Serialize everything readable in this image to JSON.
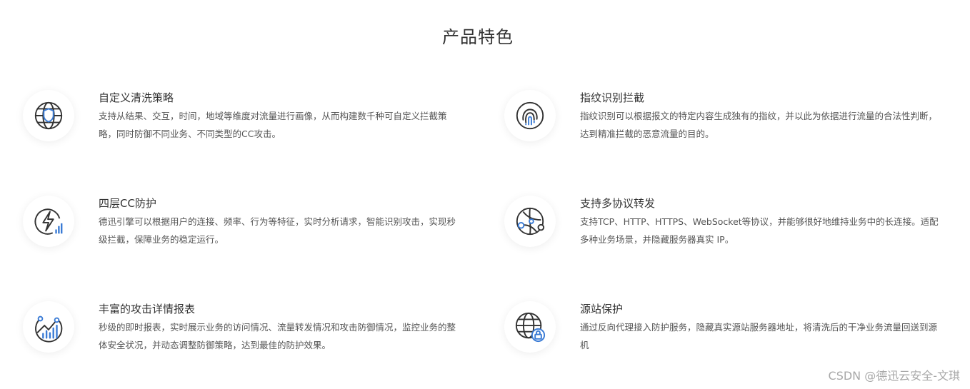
{
  "page": {
    "title": "产品特色"
  },
  "features": [
    {
      "title": "自定义清洗策略",
      "desc": "支持从结果、交互，时间，地域等维度对流量进行画像，从而构建数千种可自定义拦截策略，同时防御不同业务、不同类型的CC攻击。",
      "icon": "globe-shield-icon"
    },
    {
      "title": "指纹识别拦截",
      "desc": "指纹识别可以根据报文的特定内容生成独有的指纹，并以此为依据进行流量的合法性判断，达到精准拦截的恶意流量的目的。",
      "icon": "fingerprint-icon"
    },
    {
      "title": "四层CC防护",
      "desc": "德迅引擎可以根据用户的连接、频率、行为等特征，实时分析请求，智能识别攻击，实现秒级拦截，保障业务的稳定运行。",
      "icon": "lightning-chart-icon"
    },
    {
      "title": "支持多协议转发",
      "desc": "支持TCP、HTTP、HTTPS、WebSocket等协议，并能够很好地维持业务中的长连接。适配多种业务场景，并隐藏服务器真实 IP。",
      "icon": "network-nodes-icon"
    },
    {
      "title": "丰富的攻击详情报表",
      "desc": "秒级的即时报表，实时展示业务的访问情况、流量转发情况和攻击防御情况，监控业务的整体安全状况，并动态调整防御策略，达到最佳的防护效果。",
      "icon": "trend-chart-icon"
    },
    {
      "title": "源站保护",
      "desc": "通过反向代理接入防护服务，隐藏真实源站服务器地址，将清洗后的干净业务流量回送到源机",
      "icon": "globe-lock-icon"
    }
  ],
  "colors": {
    "accent": "#3a7bd5",
    "icon_stroke": "#333333"
  },
  "watermark": {
    "text": "CSDN @德迅云安全-文琪"
  }
}
